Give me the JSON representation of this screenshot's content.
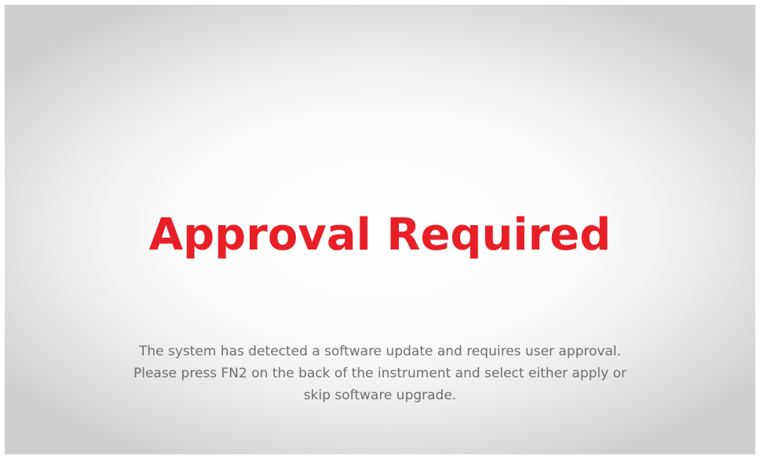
{
  "screen": {
    "title": "Approval Required",
    "title_color": "#e81f27",
    "message_lines": [
      "The system has detected a software update and requires user approval.",
      "Please press FN2 on the back of the instrument and select either apply or",
      "skip software upgrade."
    ]
  }
}
